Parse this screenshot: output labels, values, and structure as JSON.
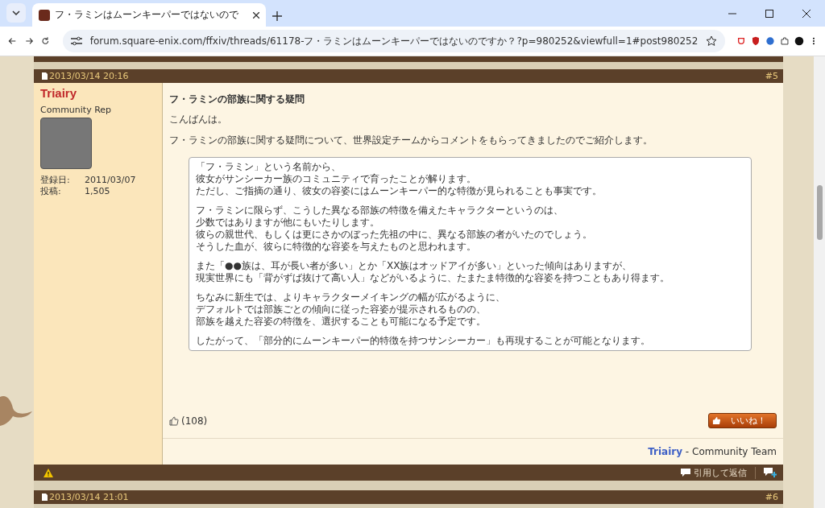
{
  "browser": {
    "tab_title": "フ・ラミンはムーンキーパーではないので",
    "url": "forum.square-enix.com/ffxiv/threads/61178-フ・ラミンはムーンキーパーではないのですか？?p=980252&viewfull=1#post980252"
  },
  "post": {
    "date": "2013/03/14 20:16",
    "number": "#5",
    "author": "Triairy",
    "rank": "Community Rep",
    "stats": [
      {
        "label": "登録日:",
        "value": "2011/03/07"
      },
      {
        "label": "投稿:",
        "value": "1,505"
      }
    ],
    "title": "フ・ラミンの部族に関する疑問",
    "greeting": "こんばんは。",
    "intro": "フ・ラミンの部族に関する疑問について、世界設定チームからコメントをもらってきましたのでご紹介します。",
    "quote": [
      [
        "「フ・ラミン」という名前から、",
        "彼女がサンシーカー族のコミュニティで育ったことが解ります。",
        "ただし、ご指摘の通り、彼女の容姿にはムーンキーパー的な特徴が見られることも事実です。"
      ],
      [
        "フ・ラミンに限らず、こうした異なる部族の特徴を備えたキャラクターというのは、",
        "少数ではありますが他にもいたりします。",
        "彼らの親世代、もしくは更にさかのぼった先祖の中に、異なる部族の者がいたのでしょう。",
        "そうした血が、彼らに特徴的な容姿を与えたものと思われます。"
      ],
      [
        "また「●●族は、耳が長い者が多い」とか「XX族はオッドアイが多い」といった傾向はありますが、",
        "現実世界にも「背がずば抜けて高い人」などがいるように、たまたま特徴的な容姿を持つこともあり得ます。"
      ],
      [
        "ちなみに新生では、よりキャラクターメイキングの幅が広がるように、",
        "デフォルトでは部族ごとの傾向に従った容姿が提示されるものの、",
        "部族を越えた容姿の特徴を、選択することも可能になる予定です。"
      ],
      [
        "したがって、「部分的にムーンキーパー的特徴を持つサンシーカー」も再現することが可能となります。"
      ]
    ],
    "likes": "(108)",
    "like_button": "いいね！",
    "signature_name": "Triairy",
    "signature_rest": "- Community Team",
    "reply_quote": "引用して返信"
  },
  "next_post": {
    "date": "2013/03/14 21:01",
    "number": "#6"
  }
}
